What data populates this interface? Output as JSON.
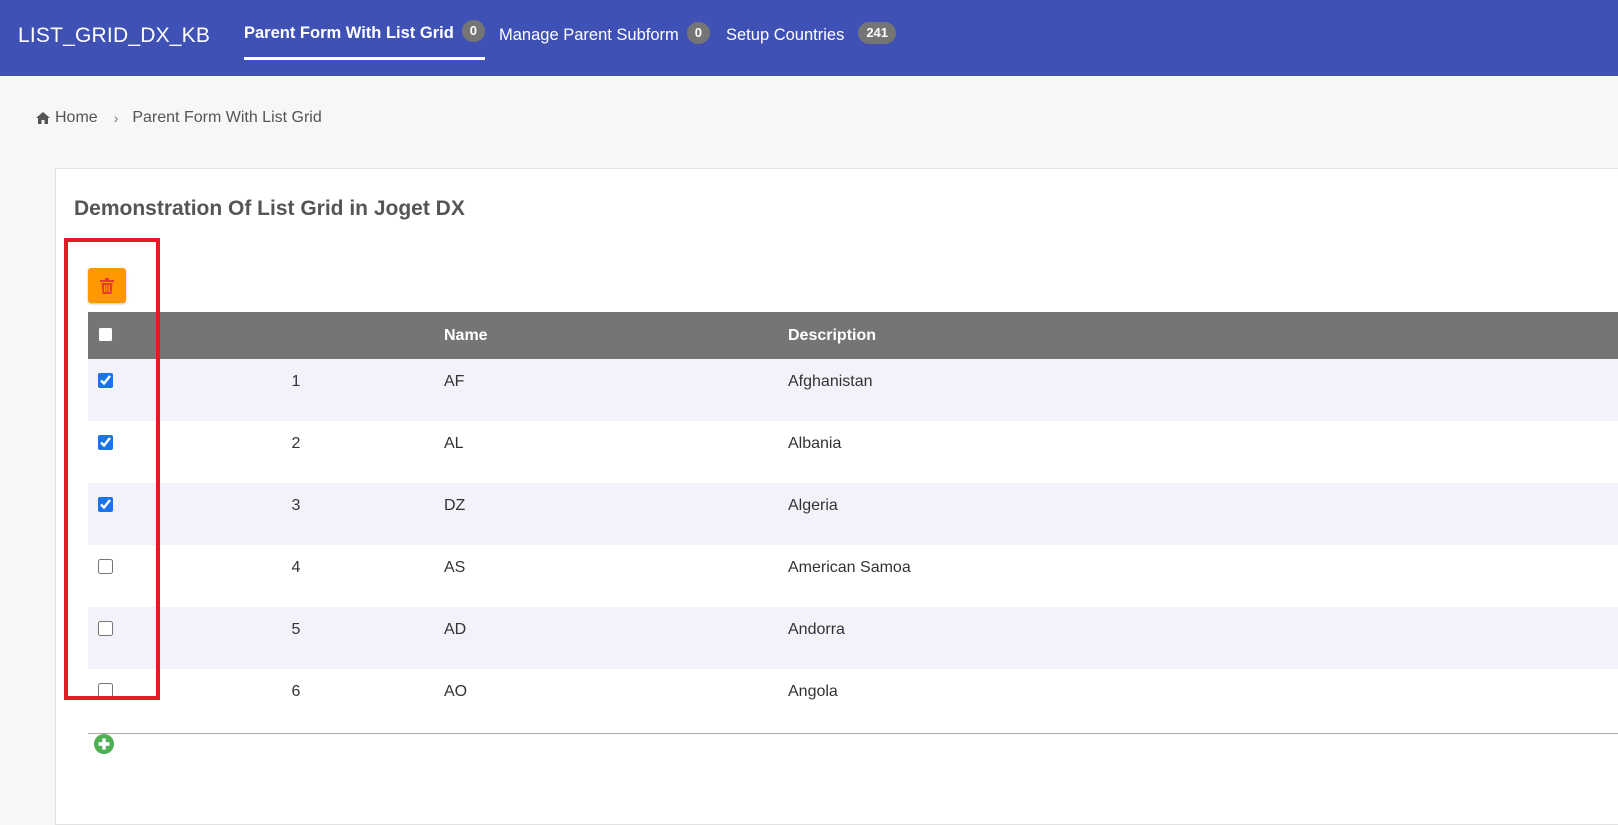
{
  "app": {
    "brand": "LIST_GRID_DX_KB"
  },
  "nav": [
    {
      "label": "Parent Form With List Grid",
      "badge": "0"
    },
    {
      "label": "Manage Parent Subform",
      "badge": "0"
    },
    {
      "label": "Setup Countries",
      "badge": "241"
    }
  ],
  "breadcrumb": {
    "home": "Home",
    "current": "Parent Form With List Grid"
  },
  "card": {
    "title": "Demonstration Of List Grid in Joget DX"
  },
  "grid": {
    "columns": {
      "name": "Name",
      "description": "Description"
    },
    "rows": [
      {
        "num": "1",
        "name": "AF",
        "description": "Afghanistan",
        "checked": true
      },
      {
        "num": "2",
        "name": "AL",
        "description": "Albania",
        "checked": true
      },
      {
        "num": "3",
        "name": "DZ",
        "description": "Algeria",
        "checked": true
      },
      {
        "num": "4",
        "name": "AS",
        "description": "American Samoa",
        "checked": false
      },
      {
        "num": "5",
        "name": "AD",
        "description": "Andorra",
        "checked": false
      },
      {
        "num": "6",
        "name": "AO",
        "description": "Angola",
        "checked": false
      }
    ]
  },
  "icons": {
    "delete": "trash-icon",
    "add": "plus-circle-icon",
    "home": "home-icon"
  },
  "colors": {
    "topbar": "#3f51b5",
    "delete_button": "#ff9800",
    "add_icon": "#4caf50",
    "highlight": "#e21c24",
    "grid_header": "#757575"
  }
}
